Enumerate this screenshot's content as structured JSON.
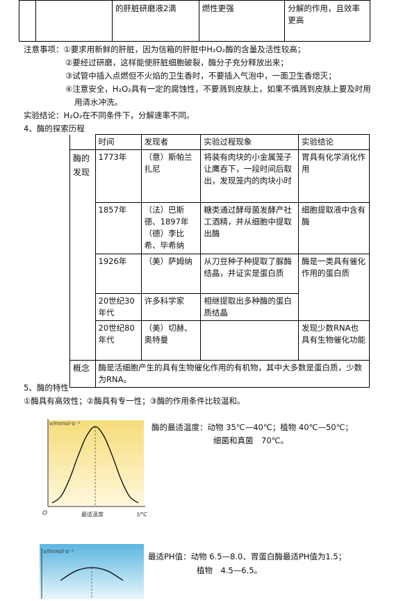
{
  "top_table": {
    "c1": "",
    "c2": "",
    "c3": "的肝脏研磨液2滴",
    "c4": "燃性更强",
    "c5": "分解的作用，且效率更高"
  },
  "notes": {
    "label": "注意事项：",
    "items": [
      "①要求用新鲜的肝脏，因为信箱的肝脏中H₂O₂酶的含量及活性较高；",
      "②要经过研磨，这样能使肝脏细胞破裂，酶分子充分释放出来；",
      "③试管中插入点燃但不火焰的卫生香时，不要插入气泡中，一面卫生香熄灭；",
      "④注意安全，H₂O₂具有一定的腐蚀性，不要溅到皮肤上，如果不慎溅到皮肤上要及时用",
      "用清水冲洗。"
    ]
  },
  "conclusion": "实验结论：H₂O₂在不同条件下，分解速率不同。",
  "section4_title": "4、酶的探索历程",
  "history_table": {
    "headers": [
      "时间",
      "发现者",
      "实验过程现象",
      "实验结论"
    ],
    "group_label": "酶的发现",
    "rows": [
      {
        "time": "1773年",
        "who": "（意）斯帕兰扎尼",
        "process": "将装有肉块的小金属笼子让鹰吞下，一段时间后取出，发现笼内的肉块小时",
        "conclusion": "胃具有化学消化作用"
      },
      {
        "time": "1857年",
        "who": "（法）巴斯德、1897年（德）李比希、毕希纳",
        "process": "糖类通过酵母菌发酵产社工酒精，并从细胞中提取出酶",
        "conclusion": "细胞提取液中含有酶"
      },
      {
        "time": "1926年",
        "who": "（美）萨姆纳",
        "process": "从刀豆种子种提取了脲酶结晶，并证实是蛋白质",
        "conclusion": "酶是一类具有催化作用的蛋白质"
      },
      {
        "time": "20世纪30年代",
        "who": "许多科学家",
        "process": "相继提取出多种酶的蛋白质结晶",
        "conclusion": ""
      },
      {
        "time": "20世纪80年代",
        "who": "（美）切赫、奥特曼",
        "process": "",
        "conclusion": "发现少数RNA也具有生物催化功能"
      }
    ],
    "concept_label": "概念",
    "concept_text": "酶是活细胞产生的具有生物催化作用的有机物，其中大多数是蛋白质，少数为RNA。"
  },
  "section5_title": "5、酶的特性",
  "properties": "①酶具有高效性；②酶具有专一性；③酶的作用条件比较温和。",
  "temp_text": {
    "line1": "酶的最适温度：动物 35℃—40℃；植物 40℃—50℃；",
    "line2": "细菌和真菌　70℃。"
  },
  "ph_text": {
    "line1": "最适PH值：动物 6.5—8.0、胃蛋白酶最适PH值为1.5；",
    "line2": "植物　4.5—6.5。"
  },
  "chart_data": [
    {
      "type": "line",
      "ylabel": "v/mmol·s⁻¹",
      "xlabel": "t/℃",
      "origin_label": "O",
      "optimum_label": "最适温度",
      "x": [
        0,
        0.1,
        0.2,
        0.3,
        0.4,
        0.5,
        0.6,
        0.7,
        0.8,
        0.9,
        1.0
      ],
      "y": [
        0.02,
        0.1,
        0.32,
        0.62,
        0.88,
        1.0,
        0.88,
        0.62,
        0.32,
        0.1,
        0.02
      ],
      "colors": {
        "bg_top": "#f6dc7a",
        "bg_bottom": "#fff8dc",
        "curve": "#000000"
      }
    },
    {
      "type": "line",
      "ylabel": "v/mmol·s⁻¹",
      "x": [
        0.2,
        0.35,
        0.5,
        0.65,
        0.8
      ],
      "y": [
        0.6,
        0.9,
        1.0,
        0.9,
        0.6
      ],
      "colors": {
        "bg_top": "#5bb6e0",
        "bg_bottom": "#e8f6fc",
        "curve": "#000000"
      }
    }
  ]
}
